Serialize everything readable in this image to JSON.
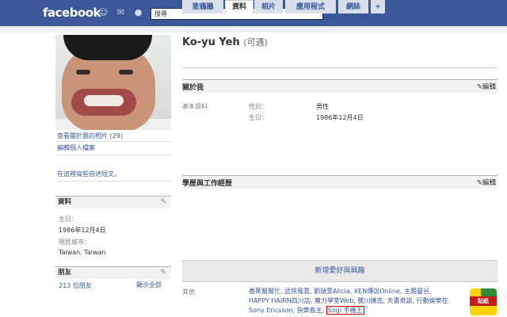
{
  "topbar": {
    "logo": "facebook",
    "search_value": "搜尋",
    "icons": [
      "friend-requests-icon",
      "messages-icon",
      "notifications-icon"
    ]
  },
  "profile": {
    "name": "Ko-yu Yeh",
    "name_suffix": "(可遇)",
    "photo_link": "查看關於我的相片 (29)",
    "edit_link": "編輯個人檔案",
    "wall_prompt": "在這裡寫些自述短文。"
  },
  "tabs": [
    {
      "label": "塗鴉牆"
    },
    {
      "label": "資料"
    },
    {
      "label": "相片"
    },
    {
      "label": "應用程式"
    },
    {
      "label": "網誌"
    },
    {
      "label": "+"
    }
  ],
  "sidebar_info": {
    "title": "資料",
    "birthday_label": "生日：",
    "birthday_value": "1986年12月4日",
    "city_label": "現居城市：",
    "city_value": "Taiwan, Taiwan"
  },
  "sidebar_friends": {
    "title": "朋友",
    "count": "213 位朋友",
    "show_all": "顯示全部"
  },
  "about": {
    "title": "關於我",
    "edit": "編輯",
    "basic_label": "基本資料",
    "gender_label": "性別：",
    "gender_value": "男性",
    "birthday_label": "生日：",
    "birthday_value": "1986年12月4日"
  },
  "education": {
    "title": "學歷與工作經歷",
    "edit": "編輯"
  },
  "interests": {
    "add_label": "新增愛好與興趣",
    "others_label": "其他",
    "others_text": "香蕉幫幫忙, 武俠風雲, 劉瑞雯Alicia, XEN傳說Online, 主題曼谷, HAPPY HAIRN四川店, 魔力學堂Web, 騰川撲克, 天書奇談, 行動娛樂在Sony Ericsson, 快樂島主,",
    "highlight": "Sogi 手機王",
    "badge_text": "貼紙"
  },
  "colors": {
    "brand": "#3b5998",
    "highlight_border": "#d60000"
  }
}
